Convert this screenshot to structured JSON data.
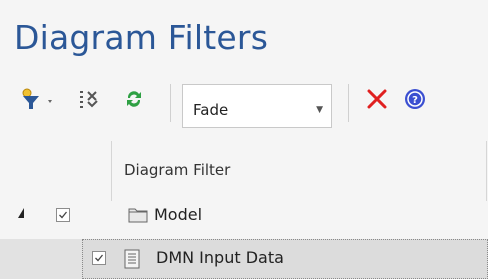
{
  "panel": {
    "title": "Diagram Filters"
  },
  "toolbar": {
    "filter_icon": "filter-icon",
    "settings_icon": "filter-settings-icon",
    "refresh_icon": "refresh-icon",
    "mode_value": "Fade",
    "delete_icon": "delete-icon",
    "help_icon": "help-icon"
  },
  "table": {
    "column_header": "Diagram Filter",
    "rows": [
      {
        "label": "Model",
        "checked": true,
        "expanded": true,
        "icon": "folder-icon"
      },
      {
        "label": "DMN Input Data",
        "checked": true,
        "icon": "document-icon"
      }
    ]
  },
  "colors": {
    "title": "#2b5797",
    "delete": "#e02020",
    "help": "#3b4fd1",
    "refresh": "#2ea043",
    "selected_row": "#dcdcdc"
  }
}
